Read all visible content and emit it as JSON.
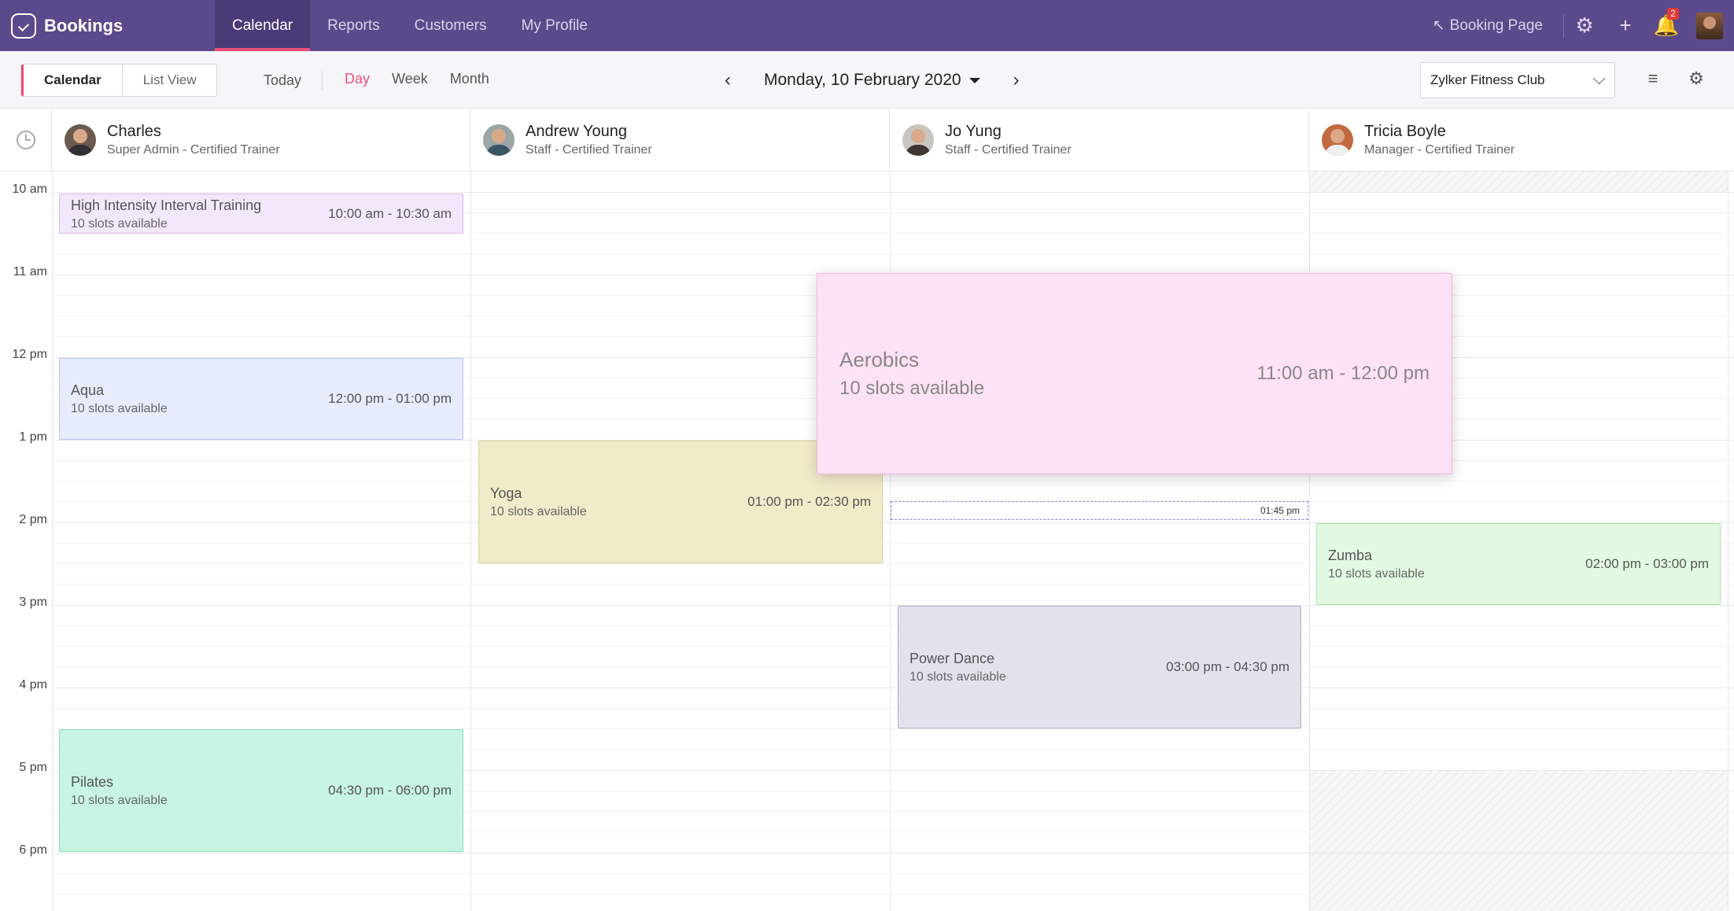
{
  "app": {
    "name": "Bookings"
  },
  "nav": {
    "tabs": [
      {
        "label": "Calendar"
      },
      {
        "label": "Reports"
      },
      {
        "label": "Customers"
      },
      {
        "label": "My Profile"
      }
    ],
    "booking_page": "Booking Page",
    "notification_count": "2",
    "icons": [
      "settings-icon",
      "add-icon",
      "bell-icon"
    ]
  },
  "toolbar": {
    "view_calendar": "Calendar",
    "view_list": "List View",
    "today": "Today",
    "ranges": [
      {
        "label": "Day"
      },
      {
        "label": "Week"
      },
      {
        "label": "Month"
      }
    ],
    "active_range": "Day",
    "date": "Monday, 10 February 2020",
    "workspace": "Zylker Fitness Club"
  },
  "staff": [
    {
      "name": "Charles",
      "role": "Super Admin - Certified Trainer"
    },
    {
      "name": "Andrew Young",
      "role": "Staff - Certified Trainer"
    },
    {
      "name": "Jo Yung",
      "role": "Staff - Certified Trainer"
    },
    {
      "name": "Tricia Boyle",
      "role": "Manager - Certified Trainer"
    }
  ],
  "time_labels": [
    "10 am",
    "11 am",
    "12 pm",
    "1 pm",
    "2 pm",
    "3 pm",
    "4 pm",
    "5 pm",
    "6 pm"
  ],
  "events": {
    "hiit": {
      "title": "High Intensity Interval Training",
      "slots": "10 slots available",
      "time": "10:00 am - 10:30 am"
    },
    "aqua": {
      "title": "Aqua",
      "slots": "10 slots available",
      "time": "12:00 pm - 01:00 pm"
    },
    "pilates": {
      "title": "Pilates",
      "slots": "10 slots available",
      "time": "04:30 pm - 06:00 pm"
    },
    "yoga": {
      "title": "Yoga",
      "slots": "10 slots available",
      "time": "01:00 pm - 02:30 pm"
    },
    "aerobics": {
      "title": "Aerobics",
      "slots": "10 slots available",
      "time": "11:00 am - 12:00 pm"
    },
    "power_dance": {
      "title": "Power Dance",
      "slots": "10 slots available",
      "time": "03:00 pm - 04:30 pm"
    },
    "zumba": {
      "title": "Zumba",
      "slots": "10 slots available",
      "time": "02:00 pm - 03:00 pm"
    }
  },
  "time_marker": "01:45 pm",
  "colors": {
    "nav_bg": "#5b4a8b",
    "accent": "#ef4e7a"
  }
}
